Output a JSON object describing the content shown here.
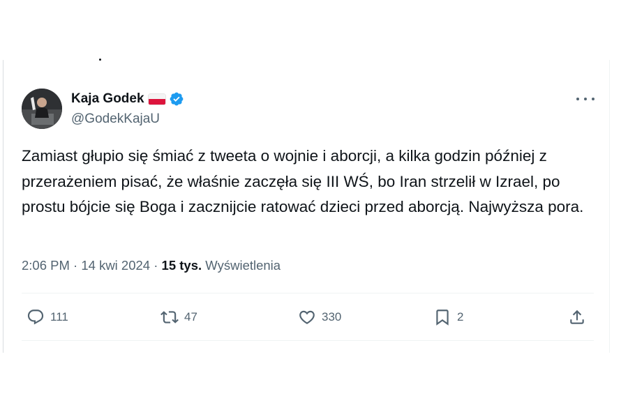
{
  "tweet": {
    "author_name": "Kaja Godek",
    "handle": "@GodekKajaU",
    "text": "Zamiast głupio się śmiać z tweeta o wojnie i aborcji, a kilka godzin później z przerażeniem pisać, że właśnie zaczęła się III WŚ, bo Iran strzelił w Izrael, po prostu bójcie się Boga i zacznijcie ratować dzieci przed aborcją. Najwyższa pora.",
    "time": "2:06 PM",
    "date": "14 kwi 2024",
    "views_count": "15 tys.",
    "views_label": "Wyświetlenia",
    "separator": "·"
  },
  "actions": {
    "replies": "111",
    "retweets": "47",
    "likes": "330",
    "bookmarks": "2"
  },
  "icons": [
    "polish-flag-icon",
    "verified-badge-icon",
    "more-icon",
    "reply-icon",
    "retweet-icon",
    "like-icon",
    "bookmark-icon",
    "share-icon"
  ],
  "colors": {
    "verified_blue": "#1d9bf0",
    "secondary_text": "#536471",
    "primary_text": "#0f1419"
  }
}
